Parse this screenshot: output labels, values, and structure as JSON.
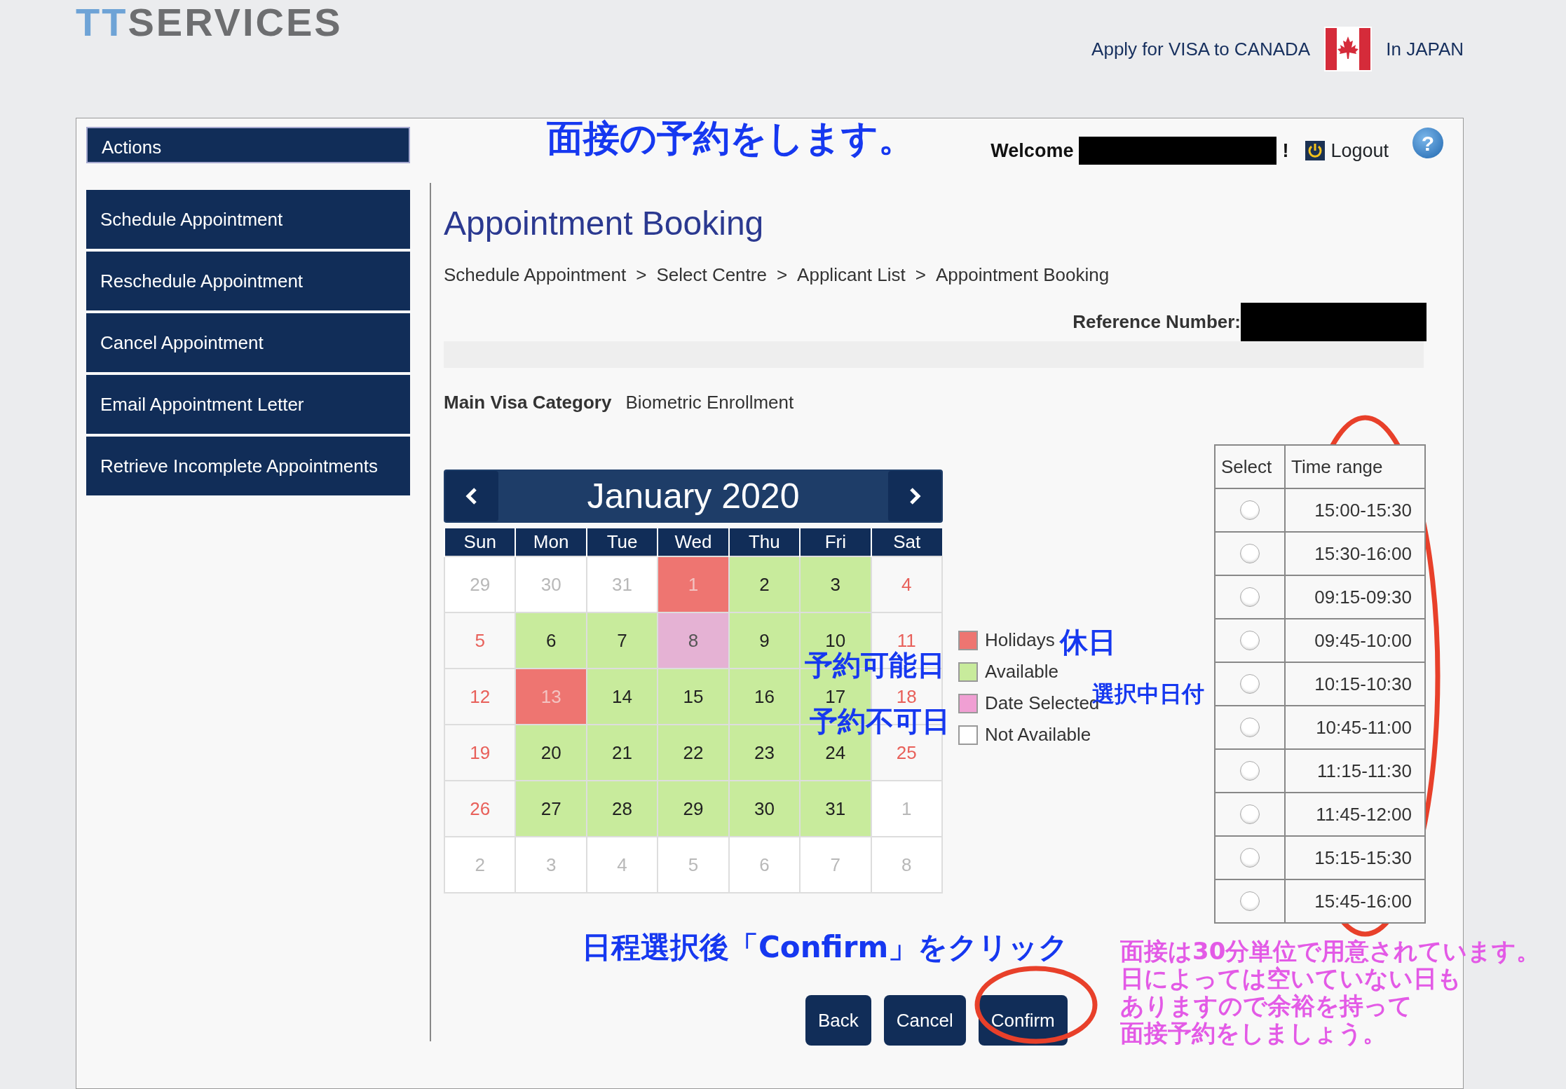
{
  "header": {
    "logo_mark": "TT",
    "logo_text": "SERVICES",
    "apply_text": "Apply for VISA to CANADA",
    "country_text": "In JAPAN"
  },
  "sidebar": {
    "title": "Actions",
    "items": [
      {
        "label": "Schedule Appointment"
      },
      {
        "label": "Reschedule Appointment"
      },
      {
        "label": "Cancel Appointment"
      },
      {
        "label": "Email Appointment Letter"
      },
      {
        "label": "Retrieve Incomplete Appointments"
      }
    ]
  },
  "user_bar": {
    "welcome": "Welcome",
    "exclaim": "!",
    "logout": "Logout",
    "help": "?"
  },
  "page_title": "Appointment Booking",
  "breadcrumb": {
    "separator": ">",
    "items": [
      "Schedule Appointment",
      "Select Centre",
      "Applicant List",
      "Appointment Booking"
    ]
  },
  "reference_label": "Reference Number:",
  "visa_category": {
    "label": "Main Visa Category",
    "value": "Biometric Enrollment"
  },
  "calendar": {
    "month": "January 2020",
    "weekdays": [
      "Sun",
      "Mon",
      "Tue",
      "Wed",
      "Thu",
      "Fri",
      "Sat"
    ],
    "weeks": [
      [
        {
          "day": "29",
          "kind": "other",
          "selected": false
        },
        {
          "day": "30",
          "kind": "other",
          "selected": false
        },
        {
          "day": "31",
          "kind": "other",
          "selected": false
        },
        {
          "day": "1",
          "kind": "holiday",
          "selected": false
        },
        {
          "day": "2",
          "kind": "available",
          "selected": false
        },
        {
          "day": "3",
          "kind": "available",
          "selected": false
        },
        {
          "day": "4",
          "kind": "weekend",
          "selected": false
        }
      ],
      [
        {
          "day": "5",
          "kind": "weekend",
          "selected": false
        },
        {
          "day": "6",
          "kind": "available",
          "selected": false
        },
        {
          "day": "7",
          "kind": "available",
          "selected": false
        },
        {
          "day": "8",
          "kind": "available",
          "selected": true
        },
        {
          "day": "9",
          "kind": "available",
          "selected": false
        },
        {
          "day": "10",
          "kind": "available",
          "selected": false
        },
        {
          "day": "11",
          "kind": "weekend",
          "selected": false
        }
      ],
      [
        {
          "day": "12",
          "kind": "weekend",
          "selected": false
        },
        {
          "day": "13",
          "kind": "holiday",
          "selected": false
        },
        {
          "day": "14",
          "kind": "available",
          "selected": false
        },
        {
          "day": "15",
          "kind": "available",
          "selected": false
        },
        {
          "day": "16",
          "kind": "available",
          "selected": false
        },
        {
          "day": "17",
          "kind": "available",
          "selected": false
        },
        {
          "day": "18",
          "kind": "weekend",
          "selected": false
        }
      ],
      [
        {
          "day": "19",
          "kind": "weekend",
          "selected": false
        },
        {
          "day": "20",
          "kind": "available",
          "selected": false
        },
        {
          "day": "21",
          "kind": "available",
          "selected": false
        },
        {
          "day": "22",
          "kind": "available",
          "selected": false
        },
        {
          "day": "23",
          "kind": "available",
          "selected": false
        },
        {
          "day": "24",
          "kind": "available",
          "selected": false
        },
        {
          "day": "25",
          "kind": "weekend",
          "selected": false
        }
      ],
      [
        {
          "day": "26",
          "kind": "weekend",
          "selected": false
        },
        {
          "day": "27",
          "kind": "available",
          "selected": false
        },
        {
          "day": "28",
          "kind": "available",
          "selected": false
        },
        {
          "day": "29",
          "kind": "available",
          "selected": false
        },
        {
          "day": "30",
          "kind": "available",
          "selected": false
        },
        {
          "day": "31",
          "kind": "available",
          "selected": false
        },
        {
          "day": "1",
          "kind": "other",
          "selected": false
        }
      ],
      [
        {
          "day": "2",
          "kind": "other",
          "selected": false
        },
        {
          "day": "3",
          "kind": "other",
          "selected": false
        },
        {
          "day": "4",
          "kind": "other",
          "selected": false
        },
        {
          "day": "5",
          "kind": "other",
          "selected": false
        },
        {
          "day": "6",
          "kind": "other",
          "selected": false
        },
        {
          "day": "7",
          "kind": "other",
          "selected": false
        },
        {
          "day": "8",
          "kind": "other",
          "selected": false
        }
      ]
    ]
  },
  "legend": [
    {
      "label": "Holidays",
      "color": "#ee7571"
    },
    {
      "label": "Available",
      "color": "#c8eb9c"
    },
    {
      "label": "Date Selected",
      "color": "#f09fd3"
    },
    {
      "label": "Not Available",
      "color": "#ffffff"
    }
  ],
  "time_table": {
    "columns": [
      "Select",
      "Time range"
    ],
    "rows": [
      {
        "time": "15:00-15:30",
        "selected": false
      },
      {
        "time": "15:30-16:00",
        "selected": false
      },
      {
        "time": "09:15-09:30",
        "selected": false
      },
      {
        "time": "09:45-10:00",
        "selected": false
      },
      {
        "time": "10:15-10:30",
        "selected": false
      },
      {
        "time": "10:45-11:00",
        "selected": false
      },
      {
        "time": "11:15-11:30",
        "selected": false
      },
      {
        "time": "11:45-12:00",
        "selected": false
      },
      {
        "time": "15:15-15:30",
        "selected": false
      },
      {
        "time": "15:45-16:00",
        "selected": false
      }
    ]
  },
  "buttons": [
    "Back",
    "Cancel",
    "Confirm"
  ],
  "annotations": [
    {
      "kind": "heading",
      "text": "面接の予約をします。"
    },
    {
      "kind": "available",
      "text": "予約可能日"
    },
    {
      "kind": "unavailable",
      "text": "予約不可日"
    },
    {
      "kind": "holiday",
      "text": "休日"
    },
    {
      "kind": "selected",
      "text": "選択中日付"
    },
    {
      "kind": "confirm",
      "text": "日程選択後「Confirm」をクリック"
    },
    {
      "kind": "note",
      "lines": [
        "面接は**30**分単位で用意されています。",
        "日によっては空いていない日も",
        "ありますので余裕を持って",
        "面接予約をしましょう。"
      ]
    }
  ]
}
